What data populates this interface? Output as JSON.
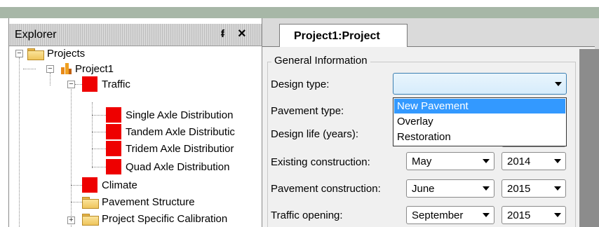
{
  "explorer": {
    "title": "Explorer",
    "pin_glyph": "ᵮ",
    "close_glyph": "✕",
    "tree": {
      "projects": "Projects",
      "project1": "Project1",
      "traffic": "Traffic",
      "single": "Single Axle Distribution",
      "tandem": "Tandem Axle Distributic",
      "tridem": "Tridem Axle Distributior",
      "quad": "Quad Axle Distribution",
      "climate": "Climate",
      "pavement_structure": "Pavement Structure",
      "calibration": "Project Specific Calibration"
    }
  },
  "document": {
    "tab_label": "Project1:Project",
    "group_title": "General Information",
    "fields": {
      "design_type": "Design type:",
      "pavement_type": "Pavement type:",
      "design_life": "Design life (years):",
      "existing_construction": "Existing construction:",
      "pavement_construction": "Pavement construction:",
      "traffic_opening": "Traffic opening:"
    },
    "values": {
      "existing_month": "May",
      "existing_year": "2014",
      "pavement_month": "June",
      "pavement_year": "2015",
      "traffic_month": "September",
      "traffic_year": "2015"
    },
    "design_type_options": [
      "New Pavement",
      "Overlay",
      "Restoration"
    ]
  },
  "colors": {
    "selection": "#3399ff",
    "traffic_icon": "#ee0000"
  }
}
